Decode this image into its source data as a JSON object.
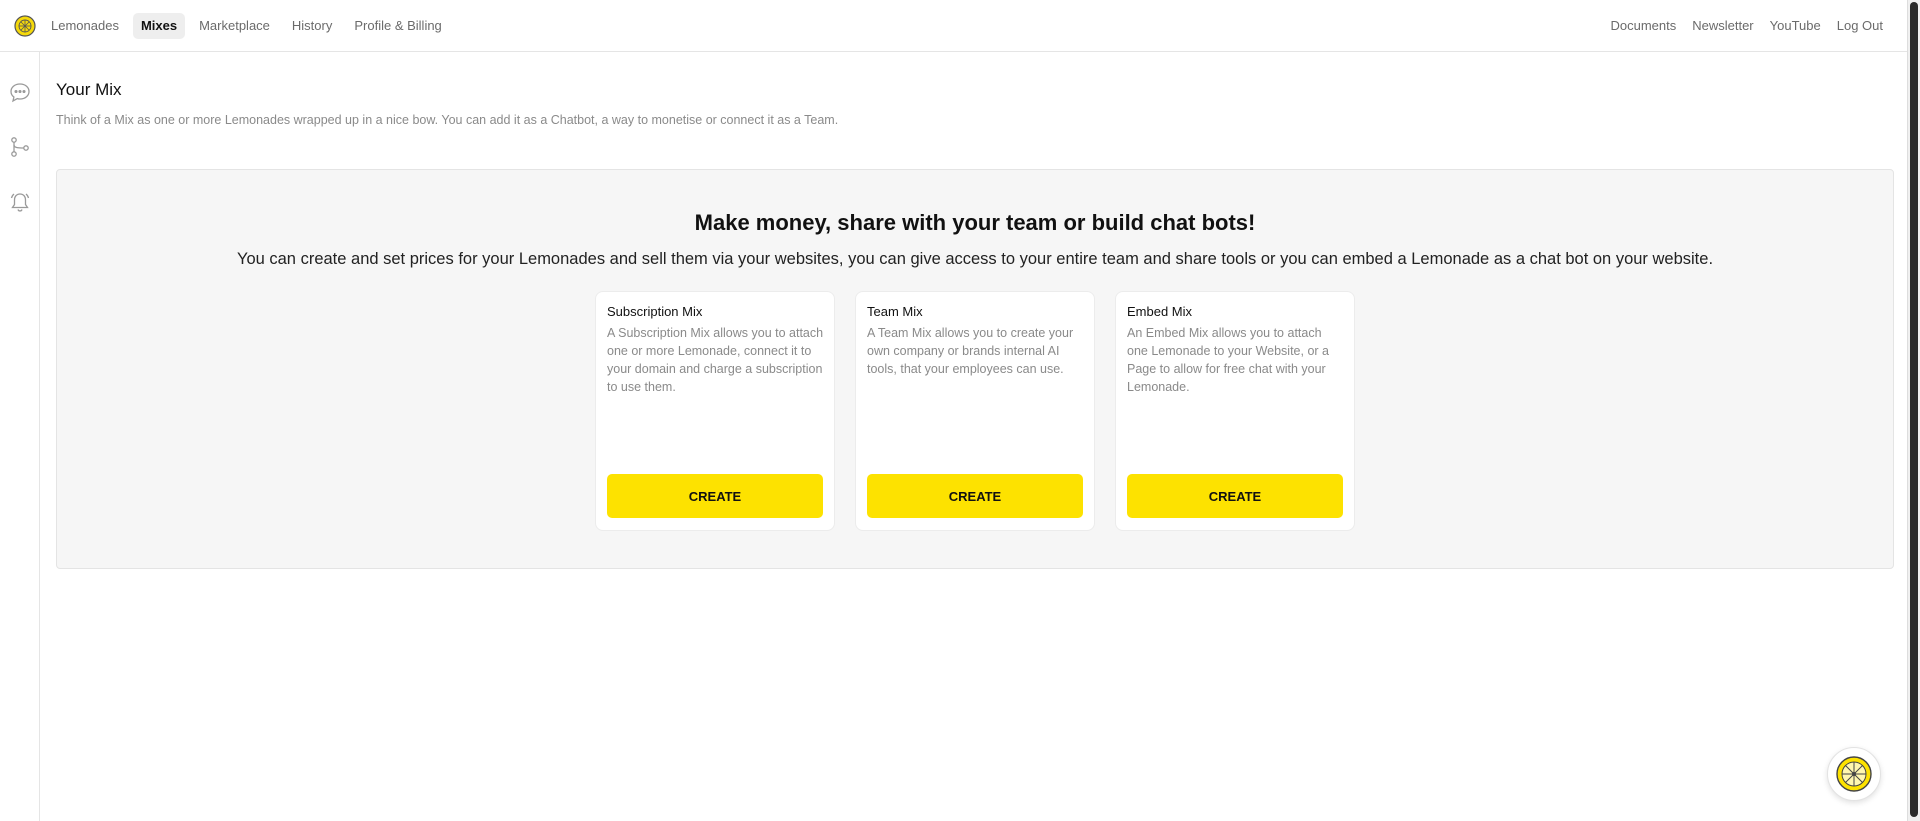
{
  "nav": {
    "left": [
      "Lemonades",
      "Mixes",
      "Marketplace",
      "History",
      "Profile & Billing"
    ],
    "active": "Mixes",
    "right": [
      "Documents",
      "Newsletter",
      "YouTube",
      "Log Out"
    ]
  },
  "sidebar": {
    "icons": [
      "chat-icon",
      "branch-icon",
      "bell-icon"
    ]
  },
  "page": {
    "title": "Your Mix",
    "subtitle": "Think of a Mix as one or more Lemonades wrapped up in a nice bow. You can add it as a Chatbot, a way to monetise or connect it as a Team."
  },
  "panel": {
    "headline": "Make money, share with your team or build chat bots!",
    "text": "You can create and set prices for your Lemonades and sell them via your websites, you can give access to your entire team and share tools or you can embed a Lemonade as a chat bot on your website."
  },
  "cards": [
    {
      "title": "Subscription Mix",
      "description": "A Subscription Mix allows you to attach one or more Lemonade, connect it to your domain and charge a subscription to use them.",
      "button": "CREATE"
    },
    {
      "title": "Team Mix",
      "description": "A Team Mix allows you to create your own company or brands internal AI tools, that your employees can use.",
      "button": "CREATE"
    },
    {
      "title": "Embed Mix",
      "description": "An Embed Mix allows you to attach one Lemonade to your Website, or a Page to allow for free chat with your Lemonade.",
      "button": "CREATE"
    }
  ],
  "colors": {
    "accent": "#fde200",
    "muted_text": "#8a8a8a",
    "panel_bg": "#f6f6f6"
  }
}
